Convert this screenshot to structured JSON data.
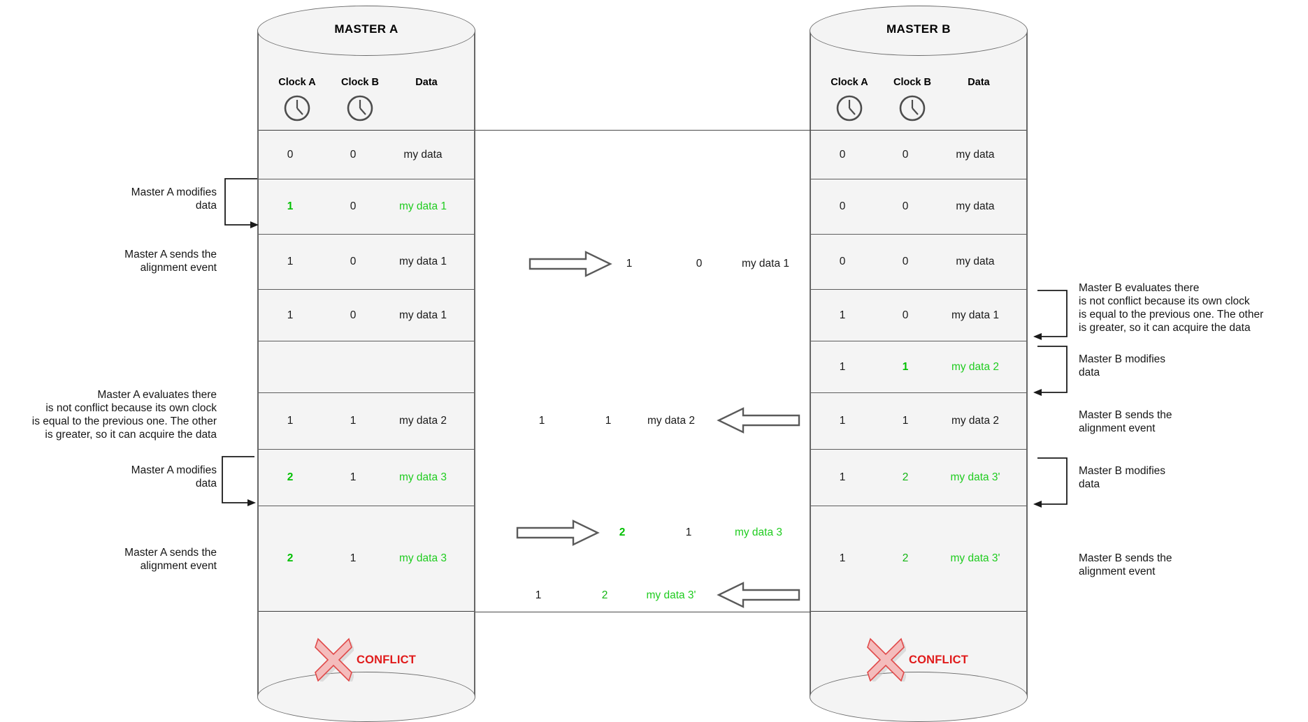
{
  "diagram": {
    "title_a": "MASTER A",
    "title_b": "MASTER B",
    "accent_green": "#1fcc1f",
    "accent_green_bold": "#00c000",
    "accent_red": "#e01b1b",
    "panel_bg": "#f4f4f4",
    "border": "#5d5d5d"
  },
  "columns": {
    "clock_a": "Clock A",
    "clock_b": "Clock B",
    "data": "Data",
    "clock_a_icon": "clock-icon",
    "clock_b_icon": "clock-icon"
  },
  "master_a": {
    "rows": [
      {
        "clock_a": "0",
        "clock_b": "0",
        "data": "my data",
        "a_green": false,
        "b_green": false,
        "d_green": false
      },
      {
        "clock_a": "1",
        "clock_b": "0",
        "data": "my data 1",
        "a_green": true,
        "b_green": false,
        "d_green": true
      },
      {
        "clock_a": "1",
        "clock_b": "0",
        "data": "my data 1",
        "a_green": false,
        "b_green": false,
        "d_green": false
      },
      {
        "clock_a": "1",
        "clock_b": "0",
        "data": "my data 1",
        "a_green": false,
        "b_green": false,
        "d_green": false
      },
      {
        "clock_a": "",
        "clock_b": "",
        "data": "",
        "a_green": false,
        "b_green": false,
        "d_green": false
      },
      {
        "clock_a": "1",
        "clock_b": "1",
        "data": "my data 2",
        "a_green": false,
        "b_green": false,
        "d_green": false
      },
      {
        "clock_a": "2",
        "clock_b": "1",
        "data": "my data 3",
        "a_green": true,
        "b_green": false,
        "d_green": true
      },
      {
        "clock_a": "2",
        "clock_b": "1",
        "data": "my data 3",
        "a_green": true,
        "b_green": false,
        "d_green": true
      }
    ],
    "conflict_label": "CONFLICT",
    "conflict_icon": "x-cross-icon"
  },
  "master_b": {
    "rows": [
      {
        "clock_a": "0",
        "clock_b": "0",
        "data": "my data",
        "a_green": false,
        "b_green": false,
        "d_green": false
      },
      {
        "clock_a": "0",
        "clock_b": "0",
        "data": "my data",
        "a_green": false,
        "b_green": false,
        "d_green": false
      },
      {
        "clock_a": "0",
        "clock_b": "0",
        "data": "my data",
        "a_green": false,
        "b_green": false,
        "d_green": false
      },
      {
        "clock_a": "1",
        "clock_b": "0",
        "data": "my data 1",
        "a_green": false,
        "b_green": false,
        "d_green": false
      },
      {
        "clock_a": "1",
        "clock_b": "1",
        "data": "my data 2",
        "a_green": false,
        "b_green": true,
        "d_green": true
      },
      {
        "clock_a": "1",
        "clock_b": "1",
        "data": "my data 2",
        "a_green": false,
        "b_green": false,
        "d_green": false
      },
      {
        "clock_a": "1",
        "clock_b": "2",
        "data": "my data 3'",
        "a_green": false,
        "b_green": true,
        "d_green": true
      },
      {
        "clock_a": "1",
        "clock_b": "2",
        "data": "my data 3'",
        "a_green": false,
        "b_green": true,
        "d_green": true
      }
    ],
    "conflict_label": "CONFLICT",
    "conflict_icon": "x-cross-icon"
  },
  "transit": [
    {
      "id": "a-to-b-1",
      "direction": "right",
      "clock_a": "1",
      "clock_b": "0",
      "data": "my data 1",
      "a_green": false,
      "b_green": false,
      "d_green": false
    },
    {
      "id": "b-to-a-1",
      "direction": "left",
      "clock_a": "1",
      "clock_b": "1",
      "data": "my data 2",
      "a_green": false,
      "b_green": false,
      "d_green": false
    },
    {
      "id": "a-to-b-2",
      "direction": "right",
      "clock_a": "2",
      "clock_b": "1",
      "data": "my data 3",
      "a_green": true,
      "b_green": false,
      "d_green": true
    },
    {
      "id": "b-to-a-2",
      "direction": "left",
      "clock_a": "1",
      "clock_b": "2",
      "data": "my data 3'",
      "a_green": false,
      "b_green": true,
      "d_green": true
    }
  ],
  "notes_left": [
    {
      "id": "a-modifies-1",
      "text": "Master A modifies\ndata",
      "bracket": true
    },
    {
      "id": "a-sends-1",
      "text": "Master A sends the\nalignment event",
      "bracket": false
    },
    {
      "id": "a-evaluates",
      "text": "Master A evaluates there\nis not conflict because its own clock\nis equal to the previous one. The other\nis greater, so it can acquire the data",
      "bracket": false
    },
    {
      "id": "a-modifies-2",
      "text": "Master A modifies\ndata",
      "bracket": true
    },
    {
      "id": "a-sends-2",
      "text": "Master A sends the\nalignment event",
      "bracket": false
    }
  ],
  "notes_right": [
    {
      "id": "b-evaluates",
      "text": "Master B evaluates there\nis not conflict because its own clock\nis equal to the previous one. The other\nis greater, so it can acquire the data",
      "bracket": true
    },
    {
      "id": "b-modifies-1",
      "text": "Master B modifies\ndata",
      "bracket": true
    },
    {
      "id": "b-sends-1",
      "text": "Master B sends the\nalignment event",
      "bracket": false
    },
    {
      "id": "b-modifies-2",
      "text": "Master B modifies\ndata",
      "bracket": true
    },
    {
      "id": "b-sends-2",
      "text": "Master B sends the\nalignment event",
      "bracket": false
    }
  ]
}
